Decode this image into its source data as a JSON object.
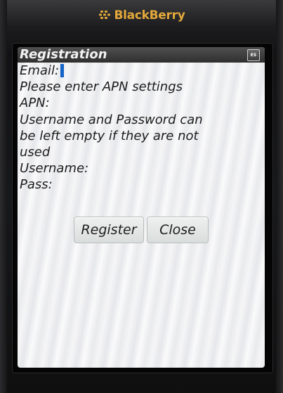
{
  "header": {
    "brand_name": "BlackBerry",
    "brand_color": "#e2a83a",
    "logo_icon": "blackberry-logo-icon"
  },
  "dialog": {
    "title": "Registration",
    "input_language_badge": "ES",
    "email_label": "Email:",
    "apn_instruction": "Please enter APN settings",
    "apn_label": "APN:",
    "credentials_note_lines": [
      "Username and Password can",
      "be left empty if they are not",
      "used"
    ],
    "username_label": "Username:",
    "password_label": "Pass:",
    "register_button_label": "Register",
    "close_button_label": "Close",
    "caret_color": "#1463c8"
  }
}
